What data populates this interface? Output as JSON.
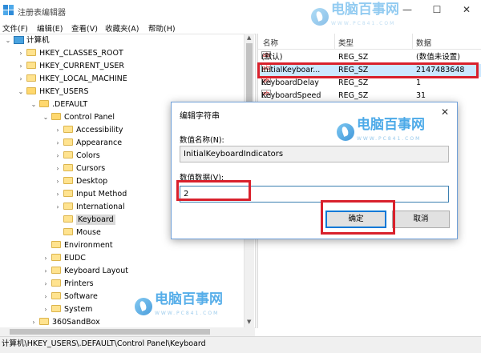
{
  "window": {
    "title": "注册表编辑器",
    "controls": [
      "—",
      "☐",
      "✕"
    ]
  },
  "menu": [
    "文件(F)",
    "编辑(E)",
    "查看(V)",
    "收藏夹(A)",
    "帮助(H)"
  ],
  "tree": {
    "root": "计算机",
    "nodes": [
      {
        "label": "HKEY_CLASSES_ROOT"
      },
      {
        "label": "HKEY_CURRENT_USER"
      },
      {
        "label": "HKEY_LOCAL_MACHINE"
      },
      {
        "label": "HKEY_USERS"
      },
      {
        "label": ".DEFAULT"
      },
      {
        "label": "Control Panel"
      },
      {
        "label": "Accessibility"
      },
      {
        "label": "Appearance"
      },
      {
        "label": "Colors"
      },
      {
        "label": "Cursors"
      },
      {
        "label": "Desktop"
      },
      {
        "label": "Input Method"
      },
      {
        "label": "International"
      },
      {
        "label": "Keyboard"
      },
      {
        "label": "Mouse"
      },
      {
        "label": "Environment"
      },
      {
        "label": "EUDC"
      },
      {
        "label": "Keyboard Layout"
      },
      {
        "label": "Printers"
      },
      {
        "label": "Software"
      },
      {
        "label": "System"
      },
      {
        "label": "360SandBox"
      }
    ]
  },
  "list": {
    "headers": {
      "name": "名称",
      "type": "类型",
      "data": "数据"
    },
    "rows": [
      {
        "name": "(默认)",
        "type": "REG_SZ",
        "data": "(数值未设置)"
      },
      {
        "name": "InitialKeyboar...",
        "type": "REG_SZ",
        "data": "2147483648"
      },
      {
        "name": "KeyboardDelay",
        "type": "REG_SZ",
        "data": "1"
      },
      {
        "name": "KeyboardSpeed",
        "type": "REG_SZ",
        "data": "31"
      }
    ]
  },
  "dialog": {
    "title": "编辑字符串",
    "name_label": "数值名称(N):",
    "name_value": "InitialKeyboardIndicators",
    "data_label": "数值数据(V):",
    "data_value": "2",
    "ok": "确定",
    "cancel": "取消"
  },
  "status": "计算机\\HKEY_USERS\\.DEFAULT\\Control Panel\\Keyboard",
  "watermark": {
    "brand": "电脑百事网",
    "url": "WWW.PC841.COM"
  },
  "colors": {
    "highlight": "#d9212c",
    "selection": "#cce8ff"
  }
}
